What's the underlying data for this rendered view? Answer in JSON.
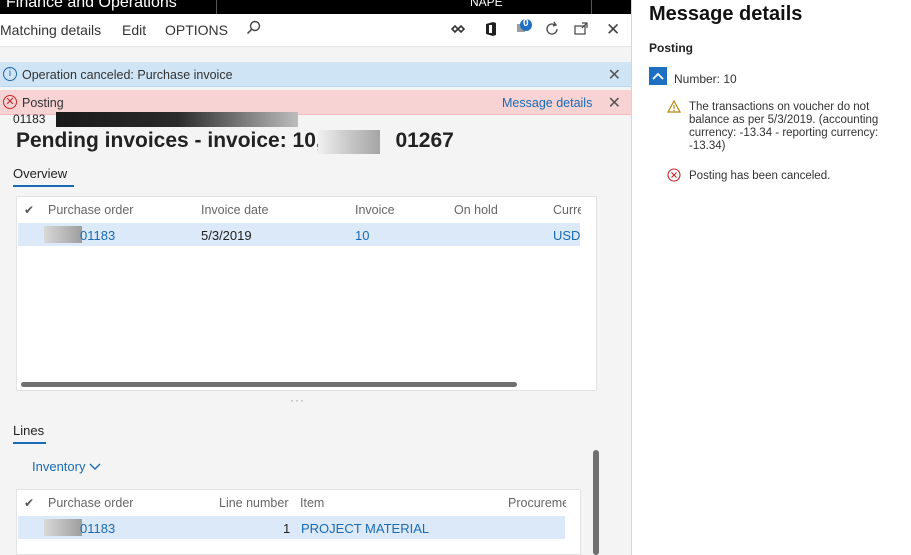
{
  "topbar": {
    "app_title": "Finance and Operations",
    "org": "NAPE"
  },
  "actionbar": {
    "matching_details": "Matching details",
    "edit": "Edit",
    "options": "OPTIONS",
    "notification_count": "0"
  },
  "info_bar": {
    "text": "Operation canceled: Purchase invoice"
  },
  "error_bar": {
    "text": "Posting",
    "link": "Message details"
  },
  "header": {
    "voucher_small": "01183",
    "title_prefix": "Pending invoices - invoice: 10,",
    "title_suffix": "01267"
  },
  "overview": {
    "tab": "Overview",
    "columns": [
      "Purchase order",
      "Invoice date",
      "Invoice",
      "On hold",
      "Curre"
    ],
    "rows": [
      {
        "purchase_order": "01183",
        "invoice_date": "5/3/2019",
        "invoice": "10",
        "on_hold": "",
        "currency": "USD"
      }
    ]
  },
  "lines": {
    "tab": "Lines",
    "inventory_menu": "Inventory",
    "columns": [
      "Purchase order",
      "Line number",
      "Item",
      "Procureme"
    ],
    "rows": [
      {
        "purchase_order": "01183",
        "line_number": "1",
        "item": "PROJECT MATERIAL",
        "procurement": ""
      }
    ]
  },
  "message_panel": {
    "title": "Message details",
    "group": "Posting",
    "number": "Number: 10",
    "messages": [
      {
        "type": "warning",
        "text": [
          "The transactions on voucher do not",
          "balance as per 5/3/2019. (accounting",
          "currency: -13.34 - reporting currency:",
          "-13.34)"
        ]
      },
      {
        "type": "error",
        "text": [
          "Posting has been canceled."
        ]
      }
    ]
  },
  "colors": {
    "accent": "#1a6bb5",
    "info_bg": "#cfe5f6",
    "error_bg": "#f8d3d3",
    "selected_row": "#dbe9f8"
  }
}
